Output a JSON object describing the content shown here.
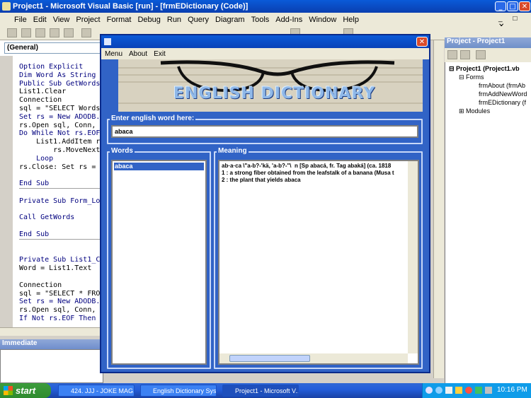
{
  "vb": {
    "title": "Project1 - Microsoft Visual Basic [run] - [frmEDictionary (Code)]",
    "menu": [
      "File",
      "Edit",
      "View",
      "Project",
      "Format",
      "Debug",
      "Run",
      "Query",
      "Diagram",
      "Tools",
      "Add-Ins",
      "Window",
      "Help"
    ],
    "object_combo": "(General)",
    "code_lines": [
      {
        "t": "Option Explicit",
        "k": true
      },
      {
        "t": "Dim Word As String",
        "k": true
      },
      {
        "t": "Public Sub GetWords(",
        "k": true
      },
      {
        "t": "List1.Clear",
        "k": false
      },
      {
        "t": "Connection",
        "k": false
      },
      {
        "t": "sql = \"SELECT Words",
        "k": false
      },
      {
        "t": "Set rs = New ADODB.R",
        "k": true
      },
      {
        "t": "rs.Open sql, Conn, a",
        "k": false
      },
      {
        "t": "Do While Not rs.EOF",
        "k": true
      },
      {
        "t": "    List1.AddItem rs",
        "k": false
      },
      {
        "t": "        rs.MoveNext",
        "k": false
      },
      {
        "t": "    Loop",
        "k": true
      },
      {
        "t": "rs.Close: Set rs = N",
        "k": false
      },
      {
        "t": "",
        "k": false
      },
      {
        "t": "End Sub",
        "k": true,
        "sep": true
      },
      {
        "t": "",
        "k": false
      },
      {
        "t": "Private Sub Form_Loa",
        "k": true
      },
      {
        "t": "",
        "k": false
      },
      {
        "t": "Call GetWords",
        "k": true
      },
      {
        "t": "",
        "k": false
      },
      {
        "t": "End Sub",
        "k": true,
        "sep": true
      },
      {
        "t": "",
        "k": false
      },
      {
        "t": "",
        "k": false
      },
      {
        "t": "Private Sub List1_Cl",
        "k": true
      },
      {
        "t": "Word = List1.Text",
        "k": false
      },
      {
        "t": "",
        "k": false
      },
      {
        "t": "Connection",
        "k": false
      },
      {
        "t": "sql = \"SELECT * FROM",
        "k": false
      },
      {
        "t": "Set rs = New ADODB.R",
        "k": true
      },
      {
        "t": "rs.Open sql, Conn, a",
        "k": false
      },
      {
        "t": "If Not rs.EOF Then",
        "k": true
      }
    ],
    "immediate_title": "Immediate",
    "project_title": "Project - Project1",
    "tree": {
      "root": "Project1 (Project1.vb",
      "forms": "Forms",
      "items": [
        "frmAbout (frmAb",
        "frmAddNewWord",
        "frmEDictionary (f"
      ],
      "modules": "Modules"
    }
  },
  "dialog": {
    "menu": [
      "Menu",
      "About",
      "Exit"
    ],
    "banner_text": "ENGLISH DICTIONARY",
    "input_label": "Enter english word here:",
    "input_value": "abaca",
    "words_label": "Words",
    "words": [
      "abaca"
    ],
    "meaning_label": "Meaning",
    "meaning_lines": [
      "ab·a·ca \\\"a-b?-'kä, 'a-b?-\"\\  n [Sp abacá, fr. Tag abaká] (ca. 1818",
      "1 : a strong fiber obtained from the leafstalk of a banana (Musa t",
      "2 : the plant that yields abaca"
    ]
  },
  "taskbar": {
    "start": "start",
    "tasks": [
      "424. JJJ - JOKE MAG...",
      "English Dictionary Sys...",
      "Project1 - Microsoft V..."
    ],
    "clock": "10:16 PM"
  },
  "colors": {
    "dialog_bg": "#3163c6",
    "title_blue": "#0a5ad8",
    "taskbar": "#245edb",
    "start_green": "#3c9c3c"
  }
}
